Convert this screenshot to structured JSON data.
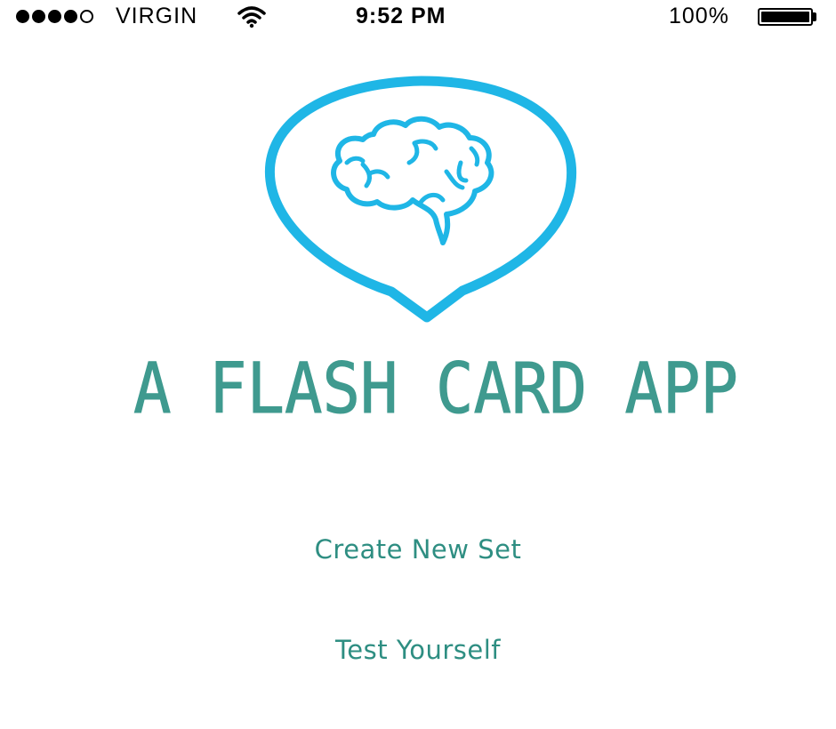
{
  "status_bar": {
    "carrier": "VIRGIN",
    "time": "9:52 PM",
    "battery_percent": "100%",
    "battery_level": 1.0,
    "signal_bars_filled": 4,
    "signal_bars_total": 5,
    "wifi_icon": "wifi-icon"
  },
  "logo": {
    "icon": "brain-pin-icon",
    "color": "#1fb6e6",
    "title": "A FLASH CARD APP",
    "title_color": "#3f9a8f"
  },
  "menu": {
    "create_label": "Create New Set",
    "test_label": "Test Yourself",
    "color": "#2e8e82"
  }
}
